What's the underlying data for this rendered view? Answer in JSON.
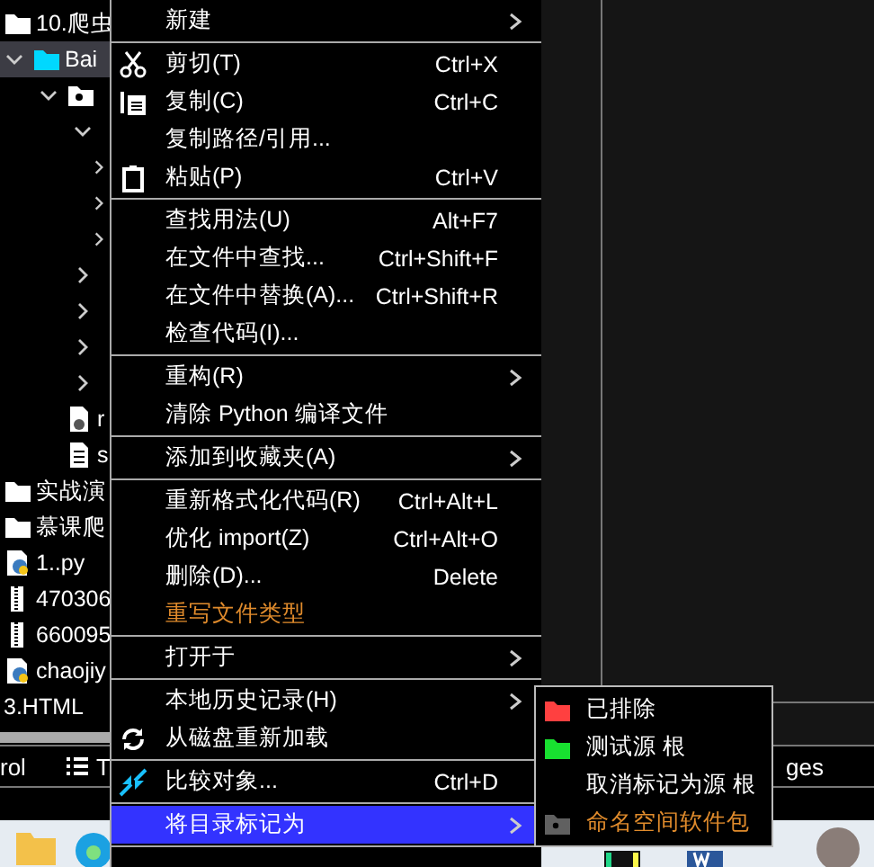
{
  "tree": [
    {
      "label": "10.爬虫",
      "kind": "folder",
      "selected": false
    },
    {
      "label": "Bai",
      "kind": "source-folder",
      "expanded": true,
      "selected": true,
      "children": [
        {
          "kind": "package",
          "expanded": true,
          "selected": false,
          "children": [
            {
              "expanded": true,
              "selected": false,
              "children": [
                {
                  "expanded": false,
                  "selected": false
                },
                {
                  "expanded": false,
                  "selected": false
                },
                {
                  "expanded": false,
                  "selected": false
                }
              ]
            },
            {
              "expanded": false,
              "selected": false
            },
            {
              "expanded": false,
              "selected": false
            },
            {
              "expanded": false,
              "selected": false
            },
            {
              "expanded": false,
              "selected": false
            },
            {
              "label": "r",
              "kind": "text-file",
              "selected": false
            },
            {
              "label": "s",
              "kind": "file",
              "selected": false
            }
          ]
        }
      ]
    },
    {
      "label": "实战演",
      "kind": "folder",
      "selected": false
    },
    {
      "label": "慕课爬",
      "kind": "folder",
      "selected": false
    },
    {
      "label": "1..py",
      "kind": "python",
      "selected": false
    },
    {
      "label": "470306",
      "kind": "archive",
      "selected": false
    },
    {
      "label": "660095",
      "kind": "archive",
      "selected": false
    },
    {
      "label": "chaojiy",
      "kind": "python",
      "selected": false
    },
    {
      "label": "3.HTML",
      "kind": "plain",
      "selected": false
    }
  ],
  "tool_tabs": [
    {
      "label": "rol",
      "kind": "plain"
    },
    {
      "label": "T",
      "kind": "list"
    }
  ],
  "right_tool_tab": "ges",
  "context_menu": [
    {
      "items": [
        {
          "label": "新建",
          "submenu": true,
          "selected": false,
          "accent": false,
          "kind": "plain"
        }
      ]
    },
    {
      "items": [
        {
          "label": "剪切(T)",
          "shortcut": "Ctrl+X",
          "submenu": false,
          "selected": false,
          "accent": false,
          "kind": "cut"
        },
        {
          "label": "复制(C)",
          "shortcut": "Ctrl+C",
          "submenu": false,
          "selected": false,
          "accent": false,
          "kind": "copy"
        },
        {
          "label": "复制路径/引用...",
          "submenu": false,
          "selected": false,
          "accent": false,
          "kind": "plain"
        },
        {
          "label": "粘贴(P)",
          "shortcut": "Ctrl+V",
          "submenu": false,
          "selected": false,
          "accent": false,
          "kind": "paste"
        }
      ]
    },
    {
      "items": [
        {
          "label": "查找用法(U)",
          "shortcut": "Alt+F7",
          "submenu": false,
          "selected": false,
          "accent": false,
          "kind": "plain"
        },
        {
          "label": "在文件中查找...",
          "shortcut": "Ctrl+Shift+F",
          "submenu": false,
          "selected": false,
          "accent": false,
          "kind": "plain"
        },
        {
          "label": "在文件中替换(A)...",
          "shortcut": "Ctrl+Shift+R",
          "submenu": false,
          "selected": false,
          "accent": false,
          "kind": "plain"
        },
        {
          "label": "检查代码(I)...",
          "submenu": false,
          "selected": false,
          "accent": false,
          "kind": "plain"
        }
      ]
    },
    {
      "items": [
        {
          "label": "重构(R)",
          "submenu": true,
          "selected": false,
          "accent": false,
          "kind": "plain"
        },
        {
          "label": "清除 Python 编译文件",
          "submenu": false,
          "selected": false,
          "accent": false,
          "kind": "plain"
        }
      ]
    },
    {
      "items": [
        {
          "label": "添加到收藏夹(A)",
          "submenu": true,
          "selected": false,
          "accent": false,
          "kind": "plain"
        }
      ]
    },
    {
      "items": [
        {
          "label": "重新格式化代码(R)",
          "shortcut": "Ctrl+Alt+L",
          "submenu": false,
          "selected": false,
          "accent": false,
          "kind": "plain"
        },
        {
          "label": "优化 import(Z)",
          "shortcut": "Ctrl+Alt+O",
          "submenu": false,
          "selected": false,
          "accent": false,
          "kind": "plain"
        },
        {
          "label": "删除(D)...",
          "shortcut": "Delete",
          "submenu": false,
          "selected": false,
          "accent": false,
          "kind": "plain"
        },
        {
          "label": "重写文件类型",
          "submenu": false,
          "selected": false,
          "accent": true,
          "kind": "plain"
        }
      ]
    },
    {
      "items": [
        {
          "label": "打开于",
          "submenu": true,
          "selected": false,
          "accent": false,
          "kind": "plain"
        }
      ]
    },
    {
      "items": [
        {
          "label": "本地历史记录(H)",
          "submenu": true,
          "selected": false,
          "accent": false,
          "kind": "plain"
        },
        {
          "label": "从磁盘重新加载",
          "submenu": false,
          "selected": false,
          "accent": false,
          "kind": "reload"
        }
      ]
    },
    {
      "items": [
        {
          "label": "比较对象...",
          "shortcut": "Ctrl+D",
          "submenu": false,
          "selected": false,
          "accent": false,
          "kind": "compare"
        }
      ]
    },
    {
      "items": [
        {
          "label": "将目录标记为",
          "submenu": true,
          "selected": true,
          "accent": false,
          "kind": "plain"
        }
      ]
    }
  ],
  "submenu": [
    {
      "label": "已排除",
      "accent": false,
      "kind": "folder",
      "color": "#ff4040"
    },
    {
      "label": "测试源 根",
      "accent": false,
      "kind": "folder",
      "color": "#18e030"
    },
    {
      "label": "取消标记为源 根",
      "accent": false,
      "kind": "plain"
    },
    {
      "label": "命名空间软件包",
      "accent": true,
      "kind": "package-folder",
      "color": "#606060"
    }
  ],
  "taskbar": [
    {
      "kind": "folder"
    },
    {
      "kind": "browser"
    },
    {
      "kind": "ide"
    },
    {
      "kind": "word"
    },
    {
      "kind": "avatar"
    }
  ]
}
